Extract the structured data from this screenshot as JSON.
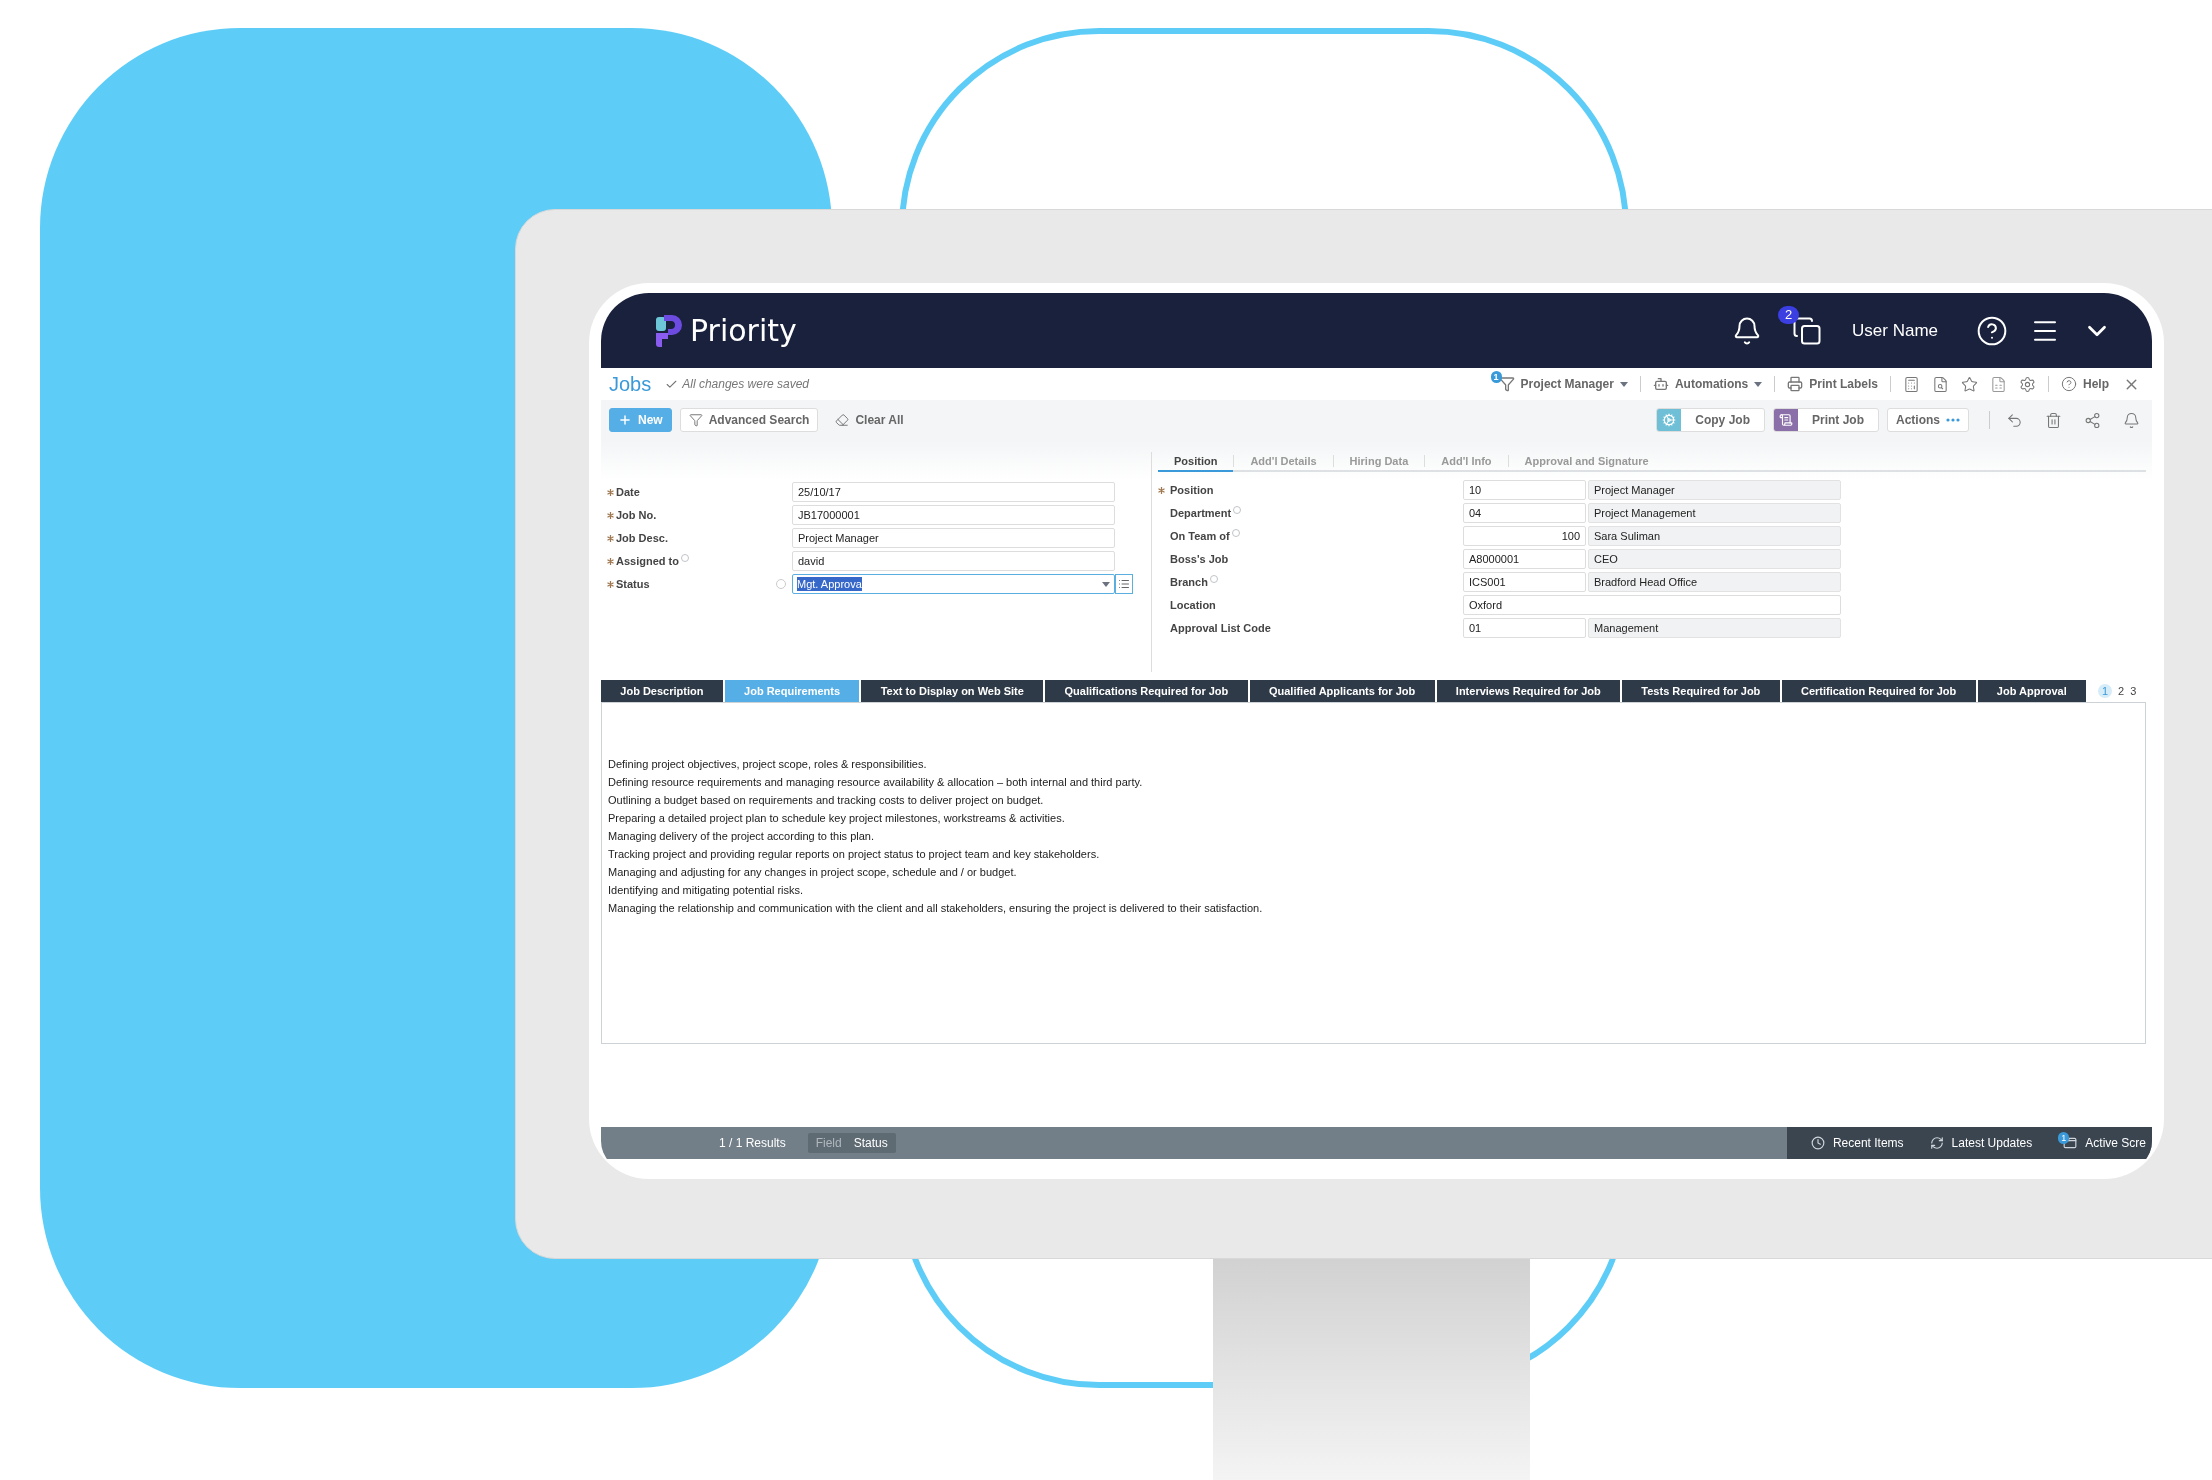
{
  "header": {
    "logo": "Priority",
    "badge": "2",
    "user_name": "User Name"
  },
  "title_bar": {
    "title": "Jobs",
    "save_status": "All changes were saved",
    "menus": [
      {
        "kind": "filter",
        "label": "Project Manager",
        "badge": "1"
      },
      {
        "kind": "automations",
        "label": "Automations"
      },
      {
        "kind": "print",
        "label": "Print Labels"
      }
    ],
    "help": "Help"
  },
  "toolbar": {
    "left": [
      {
        "kind": "new",
        "label": "New"
      },
      {
        "kind": "search",
        "label": "Advanced Search"
      },
      {
        "kind": "clear",
        "label": "Clear All"
      }
    ],
    "right": [
      {
        "kind": "copy",
        "label": "Copy Job"
      },
      {
        "kind": "print",
        "label": "Print Job"
      },
      {
        "kind": "actions",
        "label": "Actions"
      }
    ]
  },
  "form": [
    {
      "label": "Date",
      "required": true,
      "info": false,
      "value": "25/10/17",
      "kind": "text"
    },
    {
      "label": "Job No.",
      "required": true,
      "info": false,
      "value": "JB17000001",
      "kind": "text"
    },
    {
      "label": "Job Desc.",
      "required": true,
      "info": false,
      "value": "Project Manager",
      "kind": "text"
    },
    {
      "label": "Assigned to",
      "required": true,
      "info": true,
      "value": "david",
      "kind": "text"
    },
    {
      "label": "Status",
      "required": true,
      "info": false,
      "value": "Mgt. Approva",
      "kind": "select",
      "checked": false
    }
  ],
  "position_tabs": [
    {
      "label": "Position",
      "selected": true
    },
    {
      "label": "Add'l Details",
      "selected": false
    },
    {
      "label": "Hiring Data",
      "selected": false
    },
    {
      "label": "Add'l Info",
      "selected": false
    },
    {
      "label": "Approval and Signature",
      "selected": false
    }
  ],
  "position_fields": [
    {
      "label": "Position",
      "required": true,
      "info": false,
      "kind": "pair",
      "code": "10",
      "description": "Project Manager"
    },
    {
      "label": "Department",
      "required": false,
      "info": true,
      "kind": "pair",
      "code": "04",
      "description": "Project Management"
    },
    {
      "label": "On Team of",
      "required": false,
      "info": true,
      "kind": "number",
      "code": "100",
      "description": "Sara Suliman"
    },
    {
      "label": "Boss's Job",
      "required": false,
      "info": false,
      "kind": "pair",
      "code": "A8000001",
      "description": "CEO"
    },
    {
      "label": "Branch",
      "required": false,
      "info": true,
      "kind": "pair",
      "code": "ICS001",
      "description": "Bradford Head Office"
    },
    {
      "label": "Location",
      "required": false,
      "info": false,
      "kind": "wide",
      "code": "Oxford"
    },
    {
      "label": "Approval List Code",
      "required": false,
      "info": false,
      "kind": "pair",
      "code": "01",
      "description": "Management"
    }
  ],
  "detail_tabs": [
    {
      "label": "Job Description",
      "selected": false
    },
    {
      "label": "Job Requirements",
      "selected": true
    },
    {
      "label": "Text to Display on Web Site",
      "selected": false
    },
    {
      "label": "Qualifications Required for Job",
      "selected": false
    },
    {
      "label": "Qualified Applicants for Job",
      "selected": false
    },
    {
      "label": "Interviews Required for Job",
      "selected": false
    },
    {
      "label": "Tests Required for Job",
      "selected": false
    },
    {
      "label": "Certification Required for Job",
      "selected": false
    },
    {
      "label": "Job Approval",
      "selected": false
    }
  ],
  "pages": [
    {
      "label": "1",
      "selected": true
    },
    {
      "label": "2",
      "selected": false
    },
    {
      "label": "3",
      "selected": false
    }
  ],
  "requirements": [
    "Defining project objectives, project scope, roles & responsibilities.",
    "Defining resource requirements and managing resource availability & allocation – both internal and third party.",
    "Outlining a budget based on requirements and tracking costs to deliver project on budget.",
    "Preparing a detailed project plan to schedule key project milestones, workstreams & activities.",
    "Managing delivery of the project according to this plan.",
    "Tracking project and providing regular reports on project status to project team and key stakeholders.",
    "Managing and adjusting for any changes in project scope, schedule and / or budget.",
    "Identifying and mitigating potential risks.",
    "Managing the relationship and communication with the client and all stakeholders, ensuring the project is delivered to their satisfaction."
  ],
  "status_bar": {
    "results": "1 / 1 Results",
    "field_label": "Field",
    "field_value": "Status",
    "items": [
      {
        "kind": "recent",
        "label": "Recent Items"
      },
      {
        "kind": "updates",
        "label": "Latest Updates"
      },
      {
        "kind": "screens",
        "label": "Active Scre",
        "badge": "1"
      }
    ]
  }
}
